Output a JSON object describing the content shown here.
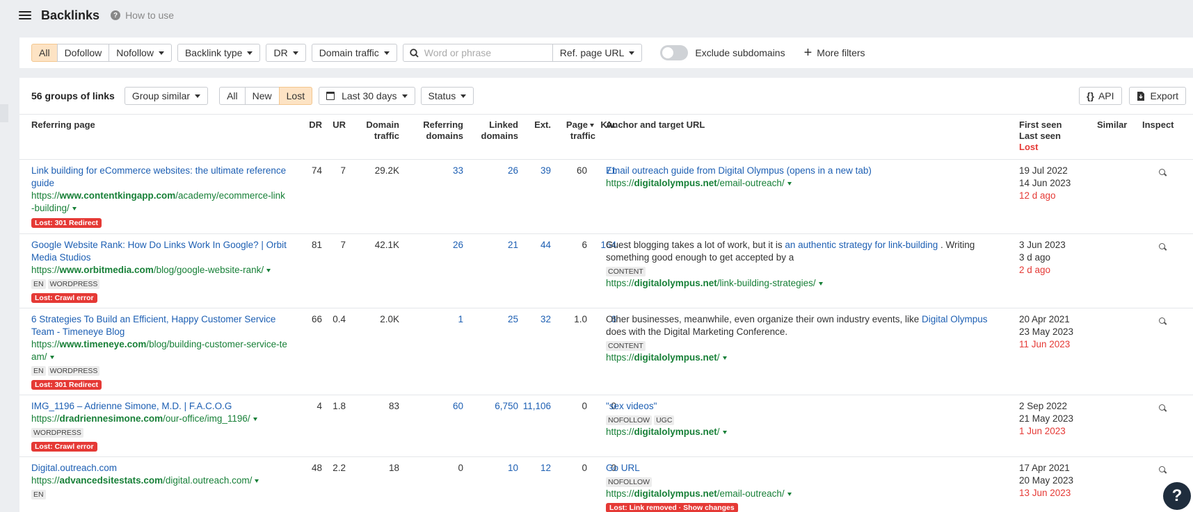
{
  "header": {
    "title": "Backlinks",
    "how_to_use": "How to use"
  },
  "filters": {
    "follow": [
      "All",
      "Dofollow",
      "Nofollow"
    ],
    "backlink_type": "Backlink type",
    "dr": "DR",
    "domain_traffic": "Domain traffic",
    "search_placeholder": "Word or phrase",
    "ref_page_url": "Ref. page URL",
    "exclude_subdomains": "Exclude subdomains",
    "more_filters": "More filters"
  },
  "toolbar": {
    "count": "56 groups of links",
    "group_similar": "Group similar",
    "status_tabs": [
      "All",
      "New",
      "Lost"
    ],
    "date_range": "Last 30 days",
    "status": "Status",
    "api": "API",
    "export": "Export"
  },
  "columns": {
    "referring_page": "Referring page",
    "dr": "DR",
    "ur": "UR",
    "domain_traffic_1": "Domain",
    "domain_traffic_2": "traffic",
    "referring_domains_1": "Referring",
    "referring_domains_2": "domains",
    "linked_domains_1": "Linked",
    "linked_domains_2": "domains",
    "ext": "Ext.",
    "page_traffic_1": "Page",
    "page_traffic_2": "traffic",
    "kw": "Kw.",
    "anchor": "Anchor and target URL",
    "first_seen": "First seen",
    "last_seen": "Last seen",
    "lost": "Lost",
    "similar": "Similar",
    "inspect": "Inspect"
  },
  "rows": [
    {
      "title_1": "Link building for eCommerce websites: the ultimate reference",
      "title_2": "guide",
      "url_prefix": "https://",
      "url_domain": "www.contentkingapp.com",
      "url_path_1": "/academy/ecommerce-link",
      "url_path_2": "-building/",
      "tags": [],
      "lost_badge": "Lost: 301 Redirect",
      "dr": "74",
      "ur": "7",
      "domain_traffic": "29.2K",
      "ref_domains": "33",
      "linked_domains": "26",
      "ext": "39",
      "page_traffic": "60",
      "kw": "71",
      "anchor_link": "Email outreach guide from Digital Olympus (opens in a new tab)",
      "target_prefix": "https://",
      "target_domain": "digitalolympus.net",
      "target_path": "/email-outreach/",
      "first_seen": "19 Jul 2022",
      "last_seen": "14 Jun 2023",
      "lost": "12 d ago"
    },
    {
      "title_1": "Google Website Rank: How Do Links Work In Google? | Orbit",
      "title_2": "Media Studios",
      "url_prefix": "https://",
      "url_domain": "www.orbitmedia.com",
      "url_path_1": "/blog/google-website-rank/",
      "tags": [
        "EN",
        "WORDPRESS"
      ],
      "lost_badge": "Lost: Crawl error",
      "dr": "81",
      "ur": "7",
      "domain_traffic": "42.1K",
      "ref_domains": "26",
      "linked_domains": "21",
      "ext": "44",
      "page_traffic": "6",
      "kw": "164",
      "anchor_pre": "Guest blogging takes a lot of work, but it is ",
      "anchor_link": "an authentic strategy for link-building",
      "anchor_post_1": " . Writing",
      "anchor_post_2": "something good enough to get accepted by a",
      "anchor_tags": [
        "CONTENT"
      ],
      "target_prefix": "https://",
      "target_domain": "digitalolympus.net",
      "target_path": "/link-building-strategies/",
      "first_seen": "3 Jun 2023",
      "last_seen": "3 d ago",
      "lost": "2 d ago"
    },
    {
      "title_1": "6 Strategies To Build an Efficient, Happy Customer Service",
      "title_2": "Team - Timeneye Blog",
      "url_prefix": "https://",
      "url_domain": "www.timeneye.com",
      "url_path_1": "/blog/building-customer-service-te",
      "url_path_2": "am/",
      "tags": [
        "EN",
        "WORDPRESS"
      ],
      "lost_badge": "Lost: 301 Redirect",
      "dr": "66",
      "ur": "0.4",
      "domain_traffic": "2.0K",
      "ref_domains": "1",
      "linked_domains": "25",
      "ext": "32",
      "page_traffic": "1.0",
      "kw": "6",
      "anchor_pre": "Other businesses, meanwhile, even organize their own industry events, like ",
      "anchor_link": "Digital Olympus",
      "anchor_post_2": "does with the Digital Marketing Conference.",
      "anchor_tags": [
        "CONTENT"
      ],
      "target_prefix": "https://",
      "target_domain": "digitalolympus.net",
      "target_path": "/",
      "first_seen": "20 Apr 2021",
      "last_seen": "23 May 2023",
      "lost": "11 Jun 2023"
    },
    {
      "title_1": "IMG_1196 – Adrienne Simone, M.D. | F.A.C.O.G",
      "url_prefix": "https://",
      "url_domain": "dradriennesimone.com",
      "url_path_1": "/our-office/img_1196/",
      "tags": [
        "WORDPRESS"
      ],
      "lost_badge": "Lost: Crawl error",
      "dr": "4",
      "ur": "1.8",
      "domain_traffic": "83",
      "ref_domains": "60",
      "linked_domains": "6,750",
      "ext": "11,106",
      "page_traffic": "0",
      "kw": "0",
      "anchor_link": "\"sex videos\"",
      "anchor_tags": [
        "NOFOLLOW",
        "UGC"
      ],
      "target_prefix": "https://",
      "target_domain": "digitalolympus.net",
      "target_path": "/",
      "first_seen": "2 Sep 2022",
      "last_seen": "21 May 2023",
      "lost": "1 Jun 2023"
    },
    {
      "title_1": "Digital.outreach.com",
      "url_prefix": "https://",
      "url_domain": "advancedsitestats.com",
      "url_path_1": "/digital.outreach.com/",
      "tags": [
        "EN"
      ],
      "dr": "48",
      "ur": "2.2",
      "domain_traffic": "18",
      "ref_domains": "0",
      "linked_domains": "10",
      "ext": "12",
      "page_traffic": "0",
      "kw": "0",
      "anchor_link": "Go URL",
      "anchor_tags": [
        "NOFOLLOW"
      ],
      "target_prefix": "https://",
      "target_domain": "digitalolympus.net",
      "target_path": "/email-outreach/",
      "link_removed": "Lost: Link removed · Show changes",
      "first_seen": "17 Apr 2021",
      "last_seen": "20 May 2023",
      "lost": "13 Jun 2023"
    }
  ],
  "help": "?"
}
